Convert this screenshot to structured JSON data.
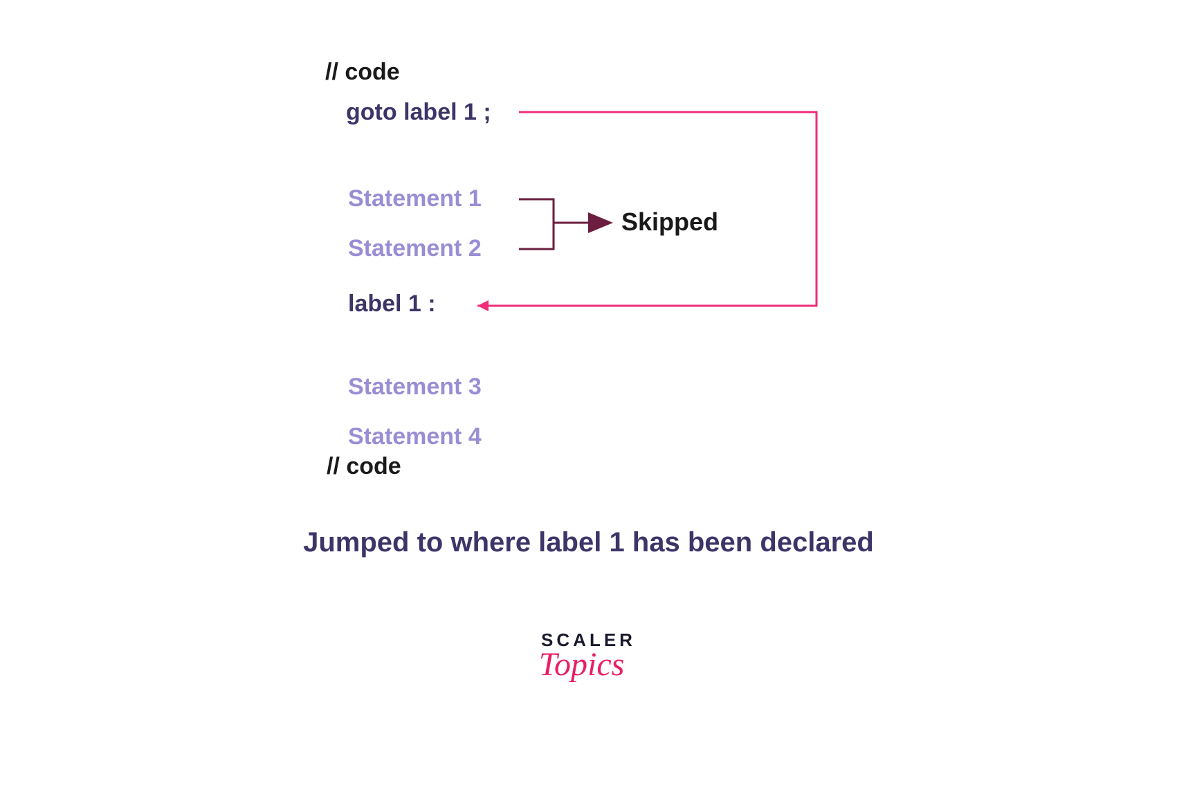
{
  "code": {
    "comment_top": "// code",
    "goto": "goto label 1 ;",
    "statement1": "Statement 1",
    "statement2": "Statement 2",
    "label": "label 1 :",
    "statement3": "Statement 3",
    "statement4": "Statement 4",
    "comment_bottom": "// code"
  },
  "annotations": {
    "skipped": "Skipped",
    "caption": "Jumped to where label 1 has been declared"
  },
  "logo": {
    "top": "SCALER",
    "bottom": "Topics"
  },
  "colors": {
    "pink": "#ee2d7b",
    "maroon": "#6b1e3f",
    "purple_dark": "#3d3568",
    "purple_light": "#9a8dd4",
    "black": "#1a1a1a"
  }
}
